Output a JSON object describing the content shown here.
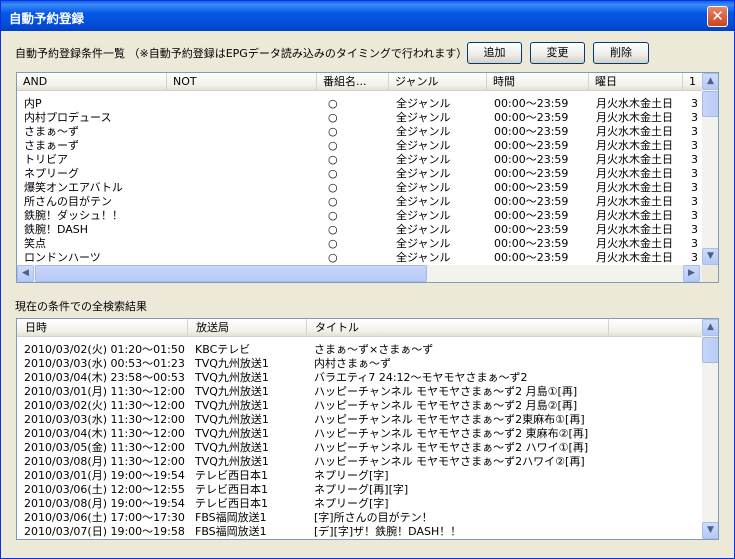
{
  "window": {
    "title": "自動予約登録",
    "close": "✕"
  },
  "top": {
    "label": "自動予約登録条件一覧 （※自動予約登録はEPGデータ読み込みのタイミングで行われます）",
    "add": "追加",
    "edit": "変更",
    "delete": "削除"
  },
  "conditions": {
    "columns": [
      "AND",
      "NOT",
      "番組名...",
      "ジャンル",
      "時間",
      "曜日",
      "1"
    ],
    "rows": [
      [
        "内P",
        "",
        "○",
        "全ジャンル",
        "00:00～23:59",
        "月火水木金土日",
        "3"
      ],
      [
        "内村プロデュース",
        "",
        "○",
        "全ジャンル",
        "00:00～23:59",
        "月火水木金土日",
        "3"
      ],
      [
        "さまぁ～ず",
        "",
        "○",
        "全ジャンル",
        "00:00～23:59",
        "月火水木金土日",
        "3"
      ],
      [
        "さまぁーず",
        "",
        "○",
        "全ジャンル",
        "00:00～23:59",
        "月火水木金土日",
        "3"
      ],
      [
        "トリビア",
        "",
        "○",
        "全ジャンル",
        "00:00～23:59",
        "月火水木金土日",
        "3"
      ],
      [
        "ネプリーグ",
        "",
        "○",
        "全ジャンル",
        "00:00～23:59",
        "月火水木金土日",
        "3"
      ],
      [
        "爆笑オンエアバトル",
        "",
        "○",
        "全ジャンル",
        "00:00～23:59",
        "月火水木金土日",
        "3"
      ],
      [
        "所さんの目がテン",
        "",
        "○",
        "全ジャンル",
        "00:00～23:59",
        "月火水木金土日",
        "3"
      ],
      [
        "鉄腕！ダッシュ！！",
        "",
        "○",
        "全ジャンル",
        "00:00～23:59",
        "月火水木金土日",
        "3"
      ],
      [
        "鉄腕！DASH",
        "",
        "○",
        "全ジャンル",
        "00:00～23:59",
        "月火水木金土日",
        "3"
      ],
      [
        "笑点",
        "",
        "○",
        "全ジャンル",
        "00:00～23:59",
        "月火水木金土日",
        "3"
      ],
      [
        "ロンドンハーツ",
        "",
        "○",
        "全ジャンル",
        "00:00～23:59",
        "月火水木金土日",
        "3"
      ]
    ]
  },
  "results_label": "現在の条件での全検索結果",
  "results": {
    "columns": [
      "日時",
      "放送局",
      "タイトル"
    ],
    "rows": [
      [
        "2010/03/02(火) 01:20～01:50",
        "KBCテレビ",
        "さまぁ～ず×さまぁ～ず"
      ],
      [
        "2010/03/03(水) 00:53～01:23",
        "TVQ九州放送1",
        "内村さまぁ～ず"
      ],
      [
        "2010/03/04(木) 23:58～00:53",
        "TVQ九州放送1",
        "バラエティ7 24:12～モヤモヤさまぁ～ず2"
      ],
      [
        "2010/03/01(月) 11:30～12:00",
        "TVQ九州放送1",
        "ハッピーチャンネル モヤモヤさまぁ～ず2 月島①[再]"
      ],
      [
        "2010/03/02(火) 11:30～12:00",
        "TVQ九州放送1",
        "ハッピーチャンネル モヤモヤさまぁ～ず2 月島②[再]"
      ],
      [
        "2010/03/03(水) 11:30～12:00",
        "TVQ九州放送1",
        "ハッピーチャンネル モヤモヤさまぁ～ず2東麻布①[再]"
      ],
      [
        "2010/03/04(木) 11:30～12:00",
        "TVQ九州放送1",
        "ハッピーチャンネル モヤモヤさまぁ～ず2 東麻布②[再]"
      ],
      [
        "2010/03/05(金) 11:30～12:00",
        "TVQ九州放送1",
        "ハッピーチャンネル モヤモヤさまぁ～ず2 ハワイ①[再]"
      ],
      [
        "2010/03/08(月) 11:30～12:00",
        "TVQ九州放送1",
        "ハッピーチャンネル モヤモヤさまぁ～ず2ハワイ②[再]"
      ],
      [
        "2010/03/01(月) 19:00～19:54",
        "テレビ西日本1",
        "ネプリーグ[字]"
      ],
      [
        "2010/03/06(土) 12:00～12:55",
        "テレビ西日本1",
        "ネプリーグ[再][字]"
      ],
      [
        "2010/03/08(月) 19:00～19:54",
        "テレビ西日本1",
        "ネプリーグ[字]"
      ],
      [
        "2010/03/06(土) 17:00～17:30",
        "FBS福岡放送1",
        "[字]所さんの目がテン！"
      ],
      [
        "2010/03/07(日) 19:00～19:58",
        "FBS福岡放送1",
        "[デ][字]ザ！鉄腕！DASH！！"
      ]
    ]
  },
  "icons": {
    "up": "▲",
    "down": "▼",
    "left": "◀",
    "right": "▶"
  }
}
